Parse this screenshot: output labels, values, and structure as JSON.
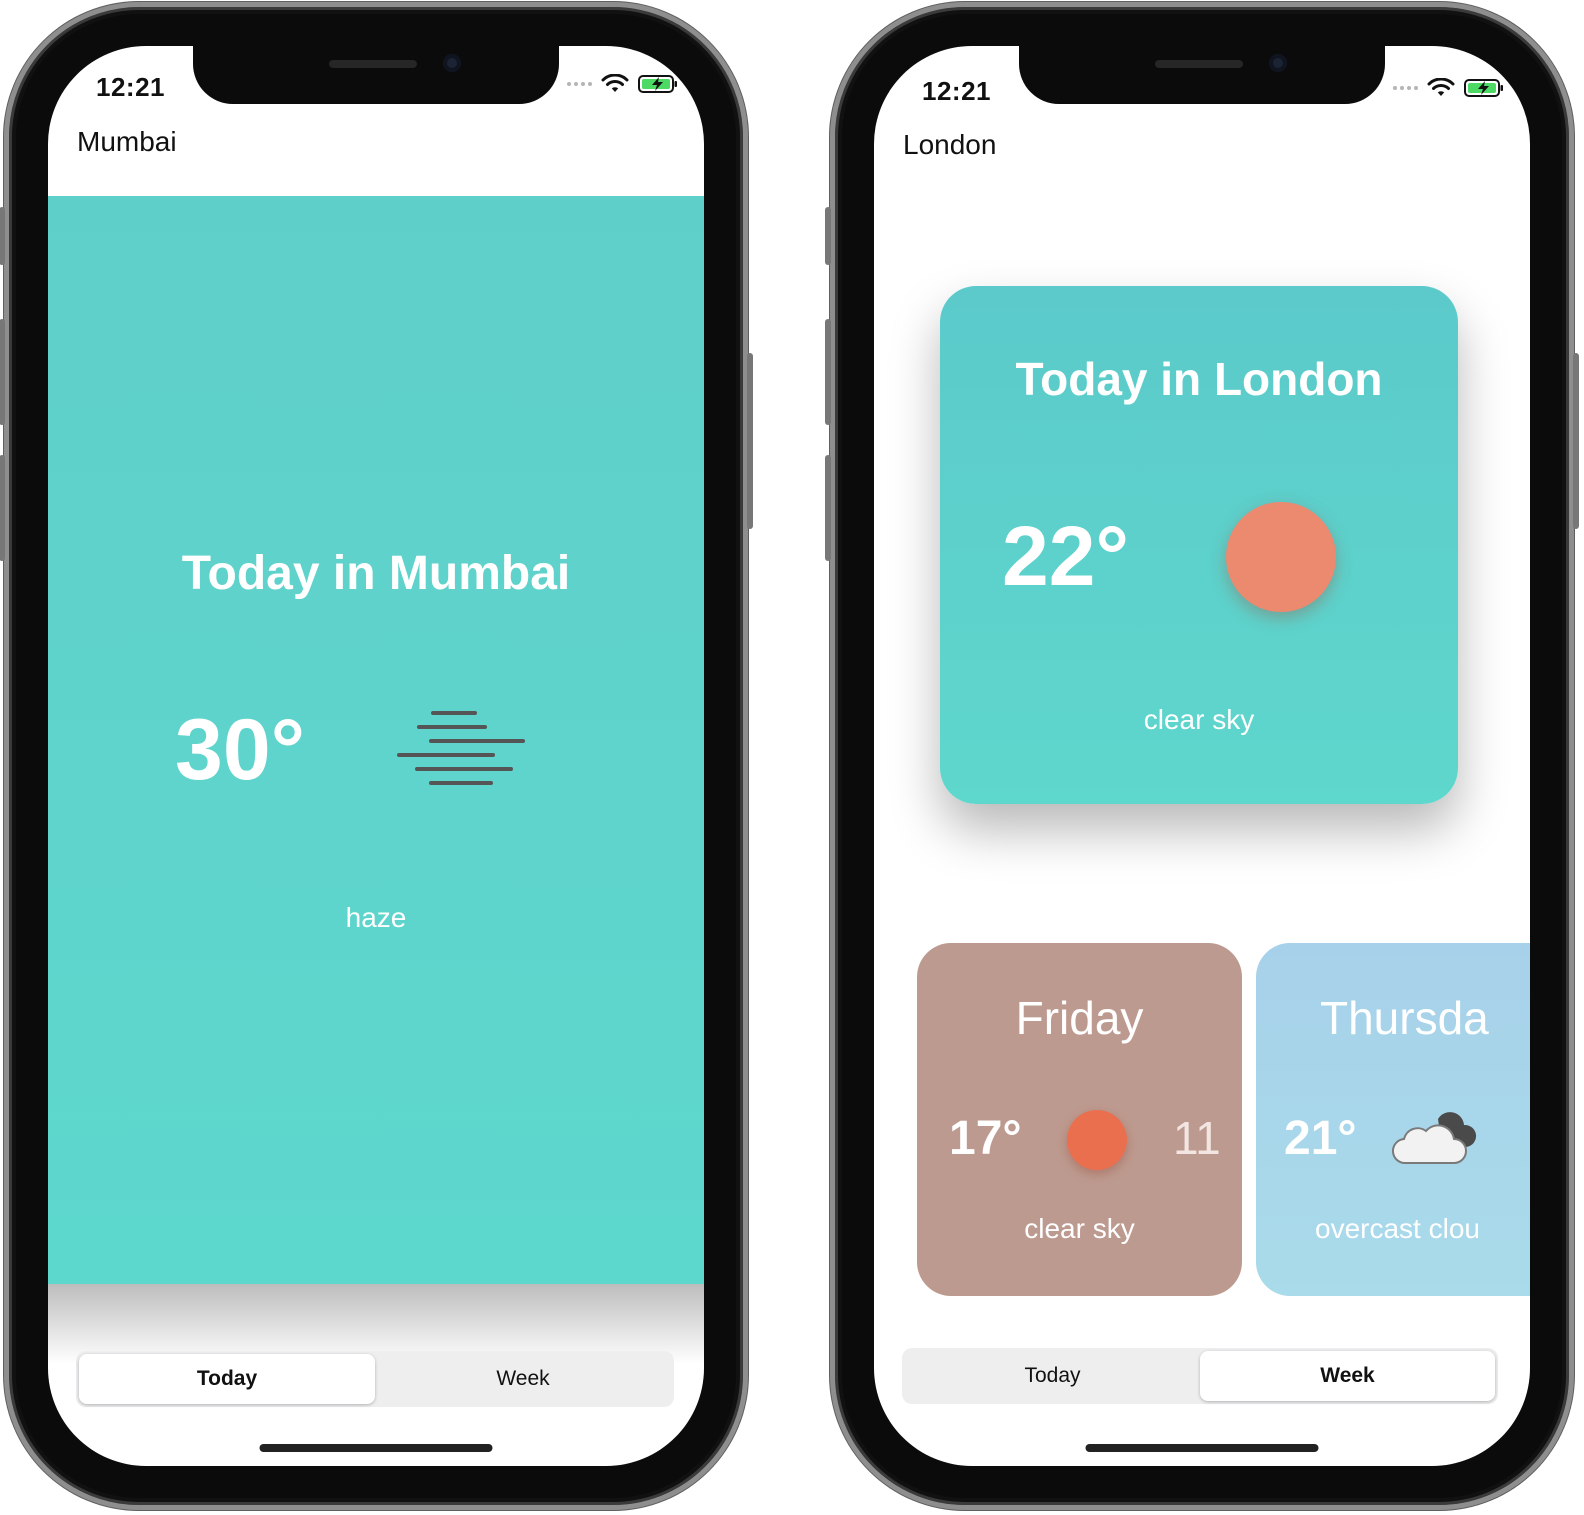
{
  "left_phone": {
    "status_bar": {
      "time": "12:21"
    },
    "city": "Mumbai",
    "today": {
      "title": "Today in Mumbai",
      "temperature": "30°",
      "condition_icon": "haze-icon",
      "description": "haze"
    },
    "tabs": [
      {
        "label": "Today",
        "selected": true
      },
      {
        "label": "Week",
        "selected": false
      }
    ]
  },
  "right_phone": {
    "status_bar": {
      "time": "12:21"
    },
    "city": "London",
    "today_card": {
      "title": "Today in London",
      "temperature": "22°",
      "condition_icon": "sun-icon",
      "description": "clear sky",
      "color": "#5dd0cc"
    },
    "week_cards": [
      {
        "day": "Friday",
        "temperature": "17°",
        "low": "11",
        "condition_icon": "sun-icon",
        "description": "clear sky",
        "color": "#bd9a8f"
      },
      {
        "day": "Thursda",
        "temperature": "21°",
        "condition_icon": "cloud-icon",
        "description": "overcast clou",
        "color": "#a8d5ea"
      }
    ],
    "tabs": [
      {
        "label": "Today",
        "selected": false
      },
      {
        "label": "Week",
        "selected": true
      }
    ]
  },
  "colors": {
    "teal": "#5ed4cc",
    "sun": "#ec8a70",
    "friday_card": "#bd9a8f",
    "thursday_card": "#a8d5ea"
  }
}
